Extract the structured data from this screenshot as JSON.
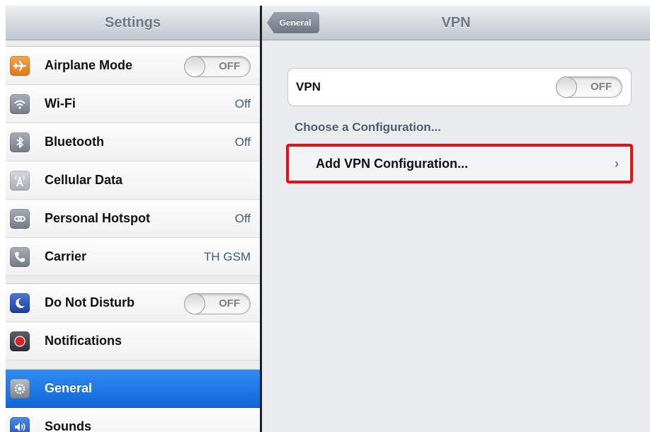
{
  "sidebar": {
    "title": "Settings",
    "group1": [
      {
        "name": "airplane-mode",
        "label": "Airplane Mode",
        "toggle": "OFF",
        "icon": "airplane-icon",
        "color": "#e8891e"
      },
      {
        "name": "wifi",
        "label": "Wi-Fi",
        "value": "Off",
        "icon": "wifi-icon",
        "color": "#8e959e"
      },
      {
        "name": "bluetooth",
        "label": "Bluetooth",
        "value": "Off",
        "icon": "bluetooth-icon",
        "color": "#8e959e"
      },
      {
        "name": "cellular-data",
        "label": "Cellular Data",
        "icon": "antenna-icon",
        "color": "#a6adb5"
      },
      {
        "name": "personal-hotspot",
        "label": "Personal Hotspot",
        "value": "Off",
        "icon": "hotspot-chain-icon",
        "color": "#8e959e"
      },
      {
        "name": "carrier",
        "label": "Carrier",
        "value": "TH GSM",
        "icon": "phone-icon",
        "color": "#8e959e"
      }
    ],
    "group2": [
      {
        "name": "do-not-disturb",
        "label": "Do Not Disturb",
        "toggle": "OFF",
        "icon": "moon-icon",
        "color": "#2c55b5"
      },
      {
        "name": "notifications",
        "label": "Notifications",
        "icon": "notifications-icon",
        "color": "#cc1f1f"
      }
    ],
    "group3": [
      {
        "name": "general",
        "label": "General",
        "selected": true,
        "icon": "gear-icon",
        "color": "#8f969e"
      },
      {
        "name": "sounds",
        "label": "Sounds",
        "icon": "speaker-icon",
        "color": "#2c6dd6"
      }
    ]
  },
  "detail": {
    "title": "VPN",
    "back_label": "General",
    "vpn_label": "VPN",
    "vpn_toggle": "OFF",
    "section_header": "Choose a Configuration...",
    "add_config_label": "Add VPN Configuration...",
    "chevron": "›"
  },
  "colors": {
    "selected_row": "#1a72e6",
    "highlight_border": "#e30f14",
    "value_text": "#3d5a8c"
  }
}
